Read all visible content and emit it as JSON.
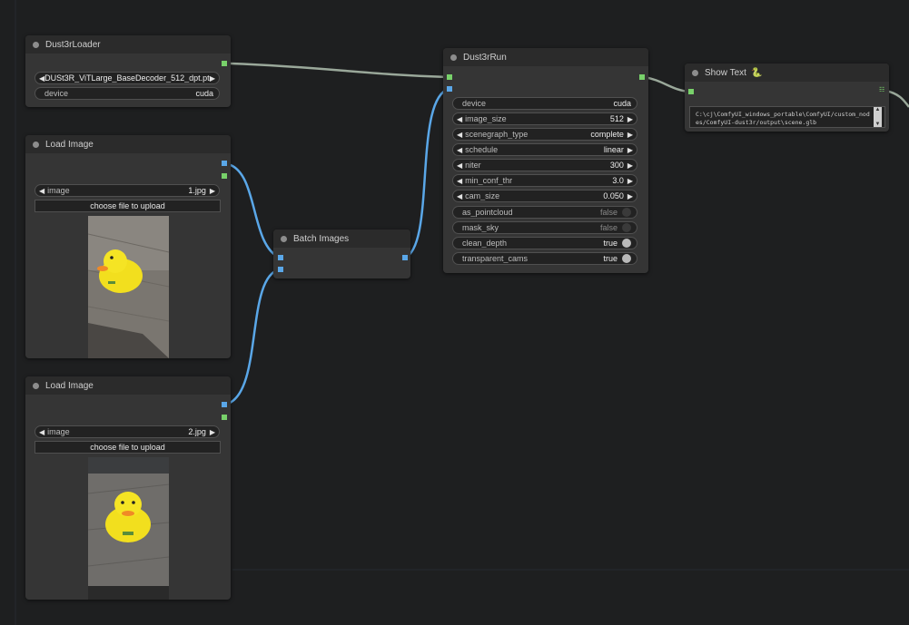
{
  "nodes": {
    "dust3r_loader": {
      "title": "Dust3rLoader",
      "model_value": "DUSt3R_ViTLarge_BaseDecoder_512_dpt.pth",
      "device_label": "device",
      "device_value": "cuda"
    },
    "load_image_1": {
      "title": "Load Image",
      "image_label": "image",
      "image_value": "1.jpg",
      "upload_label": "choose file to upload"
    },
    "load_image_2": {
      "title": "Load Image",
      "image_label": "image",
      "image_value": "2.jpg",
      "upload_label": "choose file to upload"
    },
    "batch_images": {
      "title": "Batch Images"
    },
    "dust3r_run": {
      "title": "Dust3rRun",
      "widgets": [
        {
          "label": "device",
          "value": "cuda",
          "kind": "text"
        },
        {
          "label": "image_size",
          "value": "512",
          "kind": "combo"
        },
        {
          "label": "scenegraph_type",
          "value": "complete",
          "kind": "combo"
        },
        {
          "label": "schedule",
          "value": "linear",
          "kind": "combo"
        },
        {
          "label": "niter",
          "value": "300",
          "kind": "combo"
        },
        {
          "label": "min_conf_thr",
          "value": "3.0",
          "kind": "combo"
        },
        {
          "label": "cam_size",
          "value": "0.050",
          "kind": "combo"
        },
        {
          "label": "as_pointcloud",
          "value": "false",
          "kind": "toggle"
        },
        {
          "label": "mask_sky",
          "value": "false",
          "kind": "toggle"
        },
        {
          "label": "clean_depth",
          "value": "true",
          "kind": "toggle"
        },
        {
          "label": "transparent_cams",
          "value": "true",
          "kind": "toggle"
        }
      ]
    },
    "show_text": {
      "title": "Show Text",
      "emblem": "🐍",
      "text": "C:\\cj\\ComfyUI_windows_portable\\ComfyUI/custom_nodes/ComfyUI-dust3r/output\\scene.glb"
    }
  },
  "icons": {
    "combo_left": "◀",
    "combo_right": "▶",
    "scroll_up": "▲",
    "scroll_down": "▼",
    "output_grid": "☷"
  },
  "colors": {
    "canvas": "#1e1f20",
    "node_body": "#353535",
    "link_blue": "#5aa7e8",
    "link_gray": "#9aa89a",
    "slot_green": "#78d16a"
  }
}
